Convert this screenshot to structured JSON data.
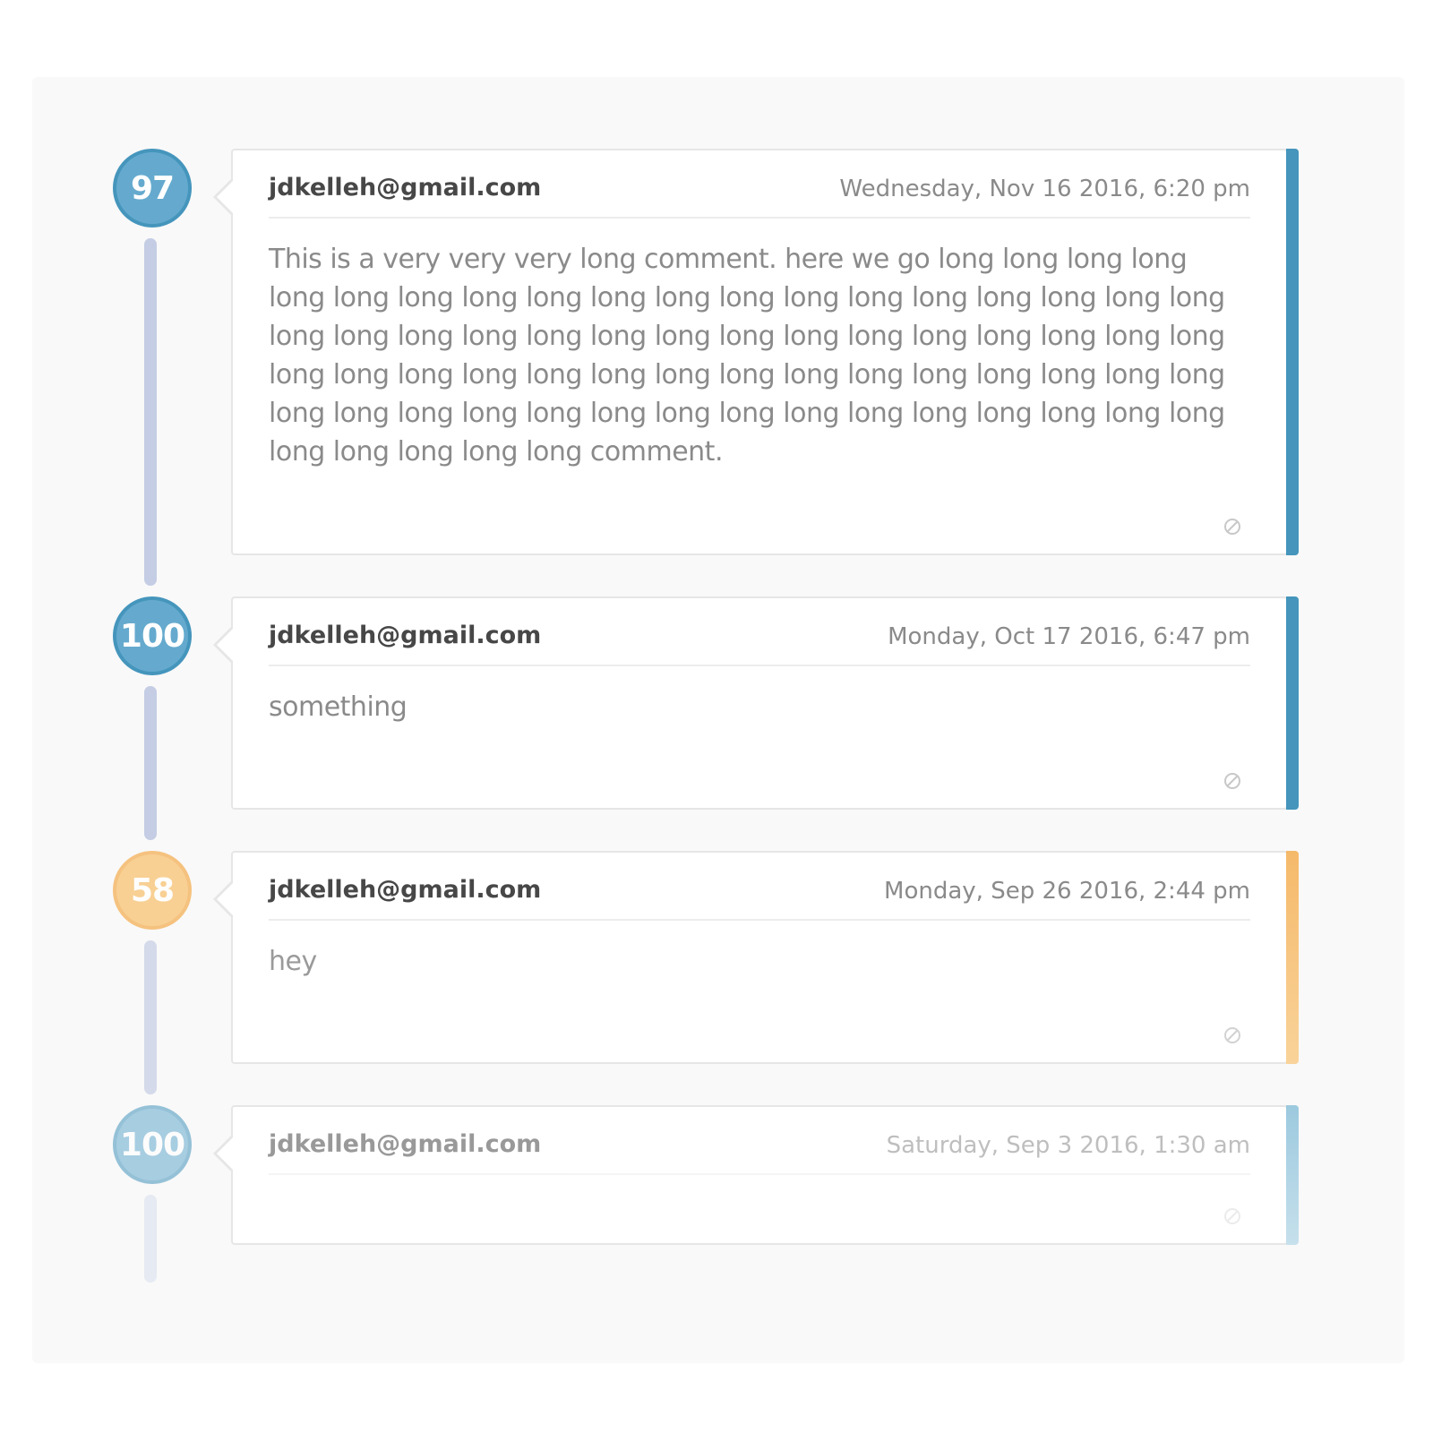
{
  "timeline": [
    {
      "score": "97",
      "tone": "blue",
      "author": "jdkelleh@gmail.com",
      "date": "Wednesday, Nov 16 2016, 6:20 pm",
      "comment": "This is a very very very long comment. here we go long long long long long long long long long long long long long long long long long long long long long long long long long long long long long long long long long long long long long long long long long long long long long long long long long long long long long long long long long long long long long long long long long long long long long comment.",
      "flag_icon": "block-icon"
    },
    {
      "score": "100",
      "tone": "blue",
      "author": "jdkelleh@gmail.com",
      "date": "Monday, Oct 17 2016, 6:47 pm",
      "comment": "something",
      "flag_icon": "block-icon"
    },
    {
      "score": "58",
      "tone": "orange",
      "author": "jdkelleh@gmail.com",
      "date": "Monday, Sep 26 2016, 2:44 pm",
      "comment": "hey",
      "flag_icon": "block-icon"
    },
    {
      "score": "100",
      "tone": "blue",
      "author": "jdkelleh@gmail.com",
      "date": "Saturday, Sep 3 2016, 1:30 am",
      "comment": "",
      "flag_icon": "block-icon"
    }
  ],
  "colors": {
    "blue_accent": "#4595bc",
    "orange_accent": "#f5b96a",
    "connector": "#c4cde4"
  }
}
